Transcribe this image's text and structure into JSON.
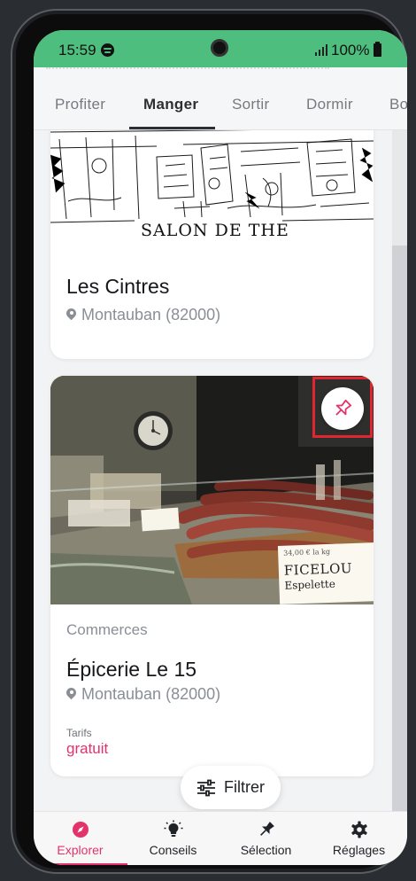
{
  "status_bar": {
    "time": "15:59",
    "battery_percent": "100%"
  },
  "top_tabs": [
    {
      "label": "Profiter",
      "active": false
    },
    {
      "label": "Manger",
      "active": true
    },
    {
      "label": "Sortir",
      "active": false
    },
    {
      "label": "Dormir",
      "active": false
    },
    {
      "label": "Bo",
      "active": false
    }
  ],
  "cards": [
    {
      "image_caption": "SALON DE THE",
      "title": "Les Cintres",
      "location": "Montauban (82000)"
    },
    {
      "category": "Commerces",
      "title": "Épicerie Le 15",
      "location": "Montauban (82000)",
      "price_label": "Tarifs",
      "price_value": "gratuit",
      "photo_sign": {
        "price": "34,00 € la kg",
        "name": "FICELOU",
        "subtitle": "Espelette"
      }
    }
  ],
  "filter_button": {
    "label": "Filtrer"
  },
  "bottom_nav": [
    {
      "label": "Explorer",
      "icon": "compass-icon",
      "active": true
    },
    {
      "label": "Conseils",
      "icon": "lightbulb-icon",
      "active": false
    },
    {
      "label": "Sélection",
      "icon": "pin-icon",
      "active": false
    },
    {
      "label": "Réglages",
      "icon": "gear-icon",
      "active": false
    }
  ],
  "colors": {
    "status_bar": "#4dbe7d",
    "accent": "#e2336b",
    "highlight_box": "#e2262f"
  }
}
